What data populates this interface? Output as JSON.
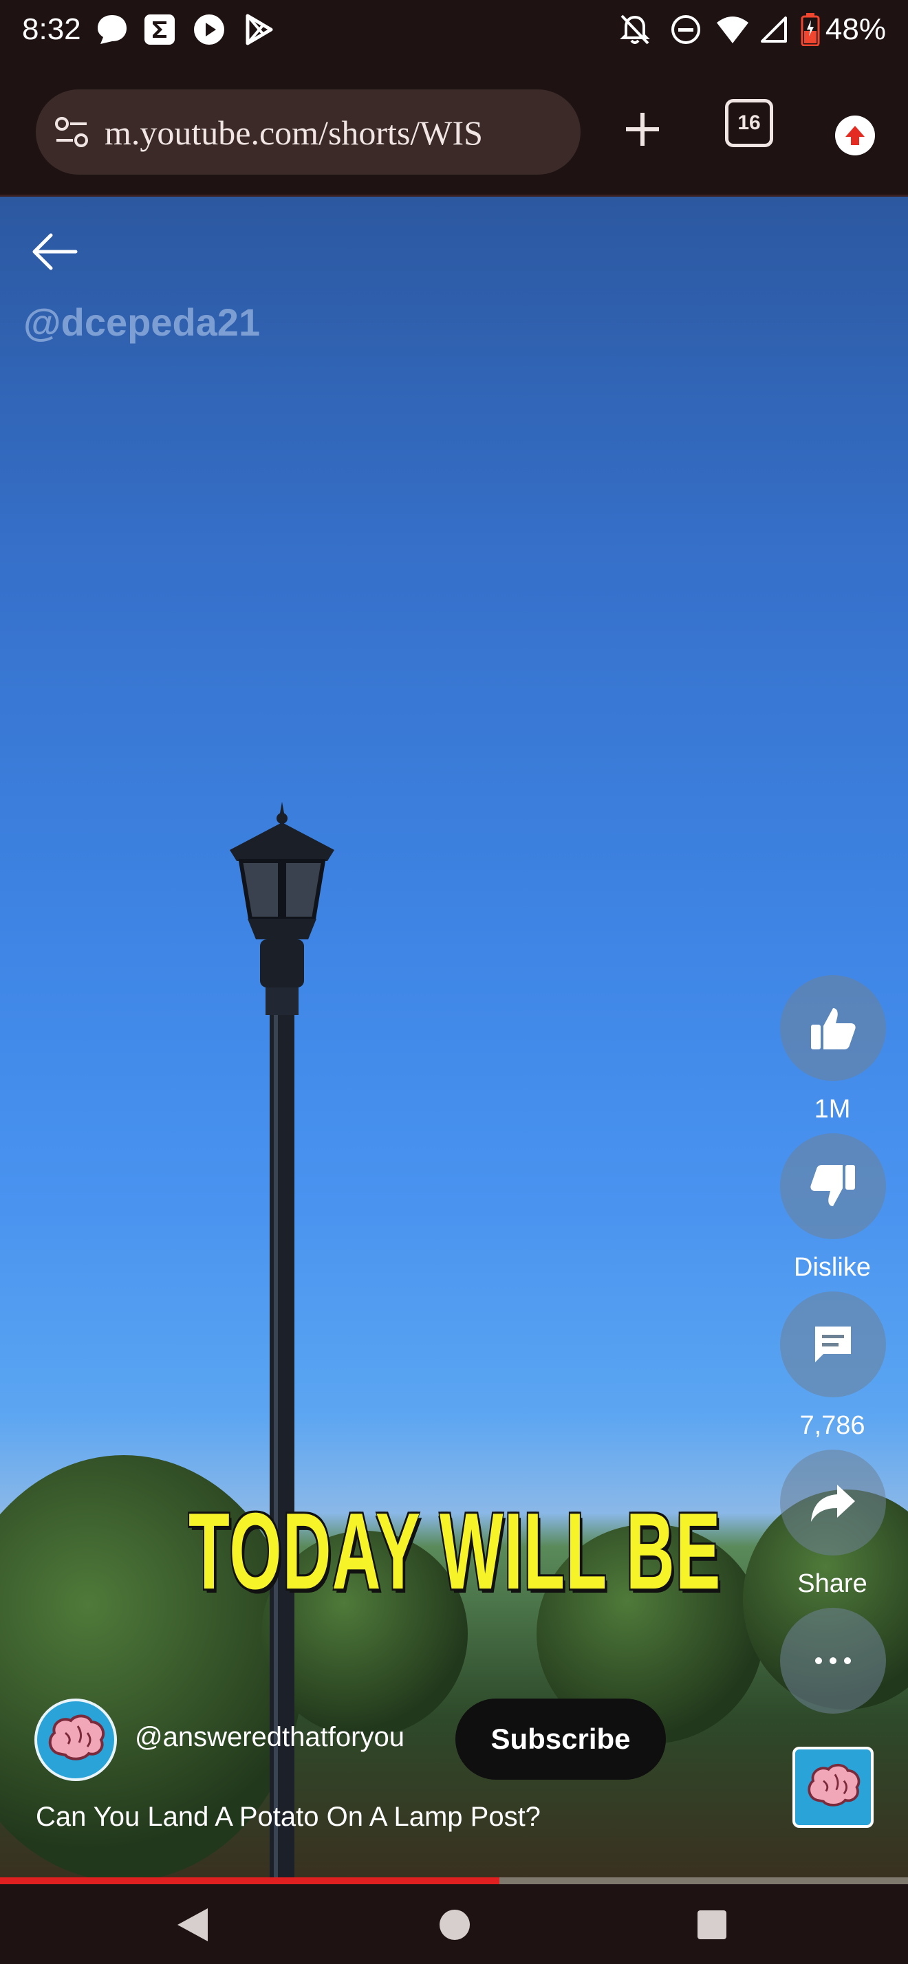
{
  "status_bar": {
    "time": "8:32",
    "battery": "48%",
    "icons": [
      "chat-bubble-icon",
      "sigma-icon",
      "play-circle-icon",
      "play-store-icon",
      "notifications-off-icon",
      "do-not-disturb-icon",
      "wifi-icon",
      "signal-icon",
      "battery-icon"
    ]
  },
  "browser": {
    "url": "m.youtube.com/shorts/WIS",
    "tab_count": "16"
  },
  "video": {
    "watermark": "@dcepeda21",
    "caption": "TODAY WILL BE"
  },
  "actions": {
    "like_count": "1M",
    "dislike_label": "Dislike",
    "comment_count": "7,786",
    "share_label": "Share"
  },
  "channel": {
    "handle": "@answeredthatforyou",
    "subscribe_label": "Subscribe"
  },
  "title": "Can You Land A Potato On A Lamp Post?",
  "progress": {
    "fraction": 0.55
  },
  "colors": {
    "accent": "#e02020",
    "caption": "#f6f328",
    "browser_bg": "#1e1212"
  }
}
